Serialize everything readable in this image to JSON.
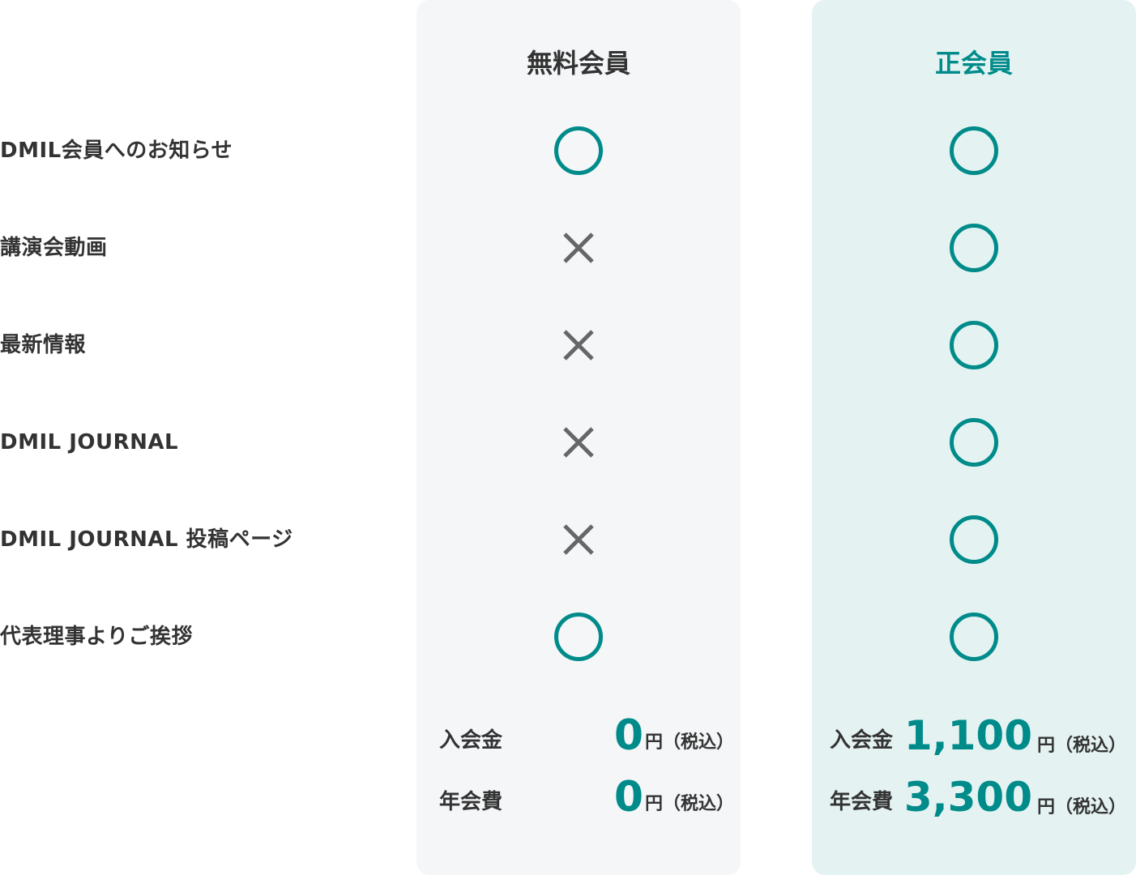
{
  "plans": {
    "free": {
      "title": "無料会員",
      "features": [
        "circle",
        "cross",
        "cross",
        "cross",
        "cross",
        "circle"
      ],
      "fees": {
        "admission_label": "入会金",
        "admission_amount": "0",
        "annual_label": "年会費",
        "annual_amount": "0",
        "unit": "円（税込）"
      }
    },
    "full": {
      "title": "正会員",
      "features": [
        "circle",
        "circle",
        "circle",
        "circle",
        "circle",
        "circle"
      ],
      "fees": {
        "admission_label": "入会金",
        "admission_amount": "1,100",
        "annual_label": "年会費",
        "annual_amount": "3,300",
        "unit": "円（税込）"
      }
    }
  },
  "features": [
    "DMIL会員へのお知らせ",
    "講演会動画",
    "最新情報",
    "DMIL JOURNAL",
    "DMIL JOURNAL 投稿ページ",
    "代表理事よりご挨拶"
  ],
  "colors": {
    "accent": "#008b8b",
    "free_bg": "#f4f6f8",
    "full_bg": "#e4f3f2",
    "cross": "#666666",
    "text": "#333333"
  },
  "icons": {
    "available": "circle-icon",
    "unavailable": "cross-icon"
  }
}
